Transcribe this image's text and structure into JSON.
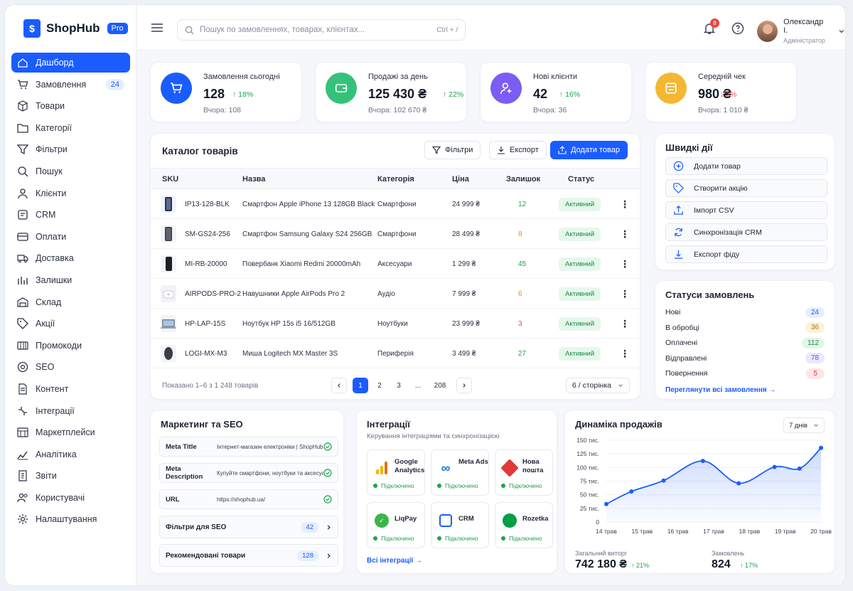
{
  "app": {
    "name": "ShopHub",
    "badge": "Pro"
  },
  "sidebar": {
    "items": [
      {
        "label": "Дашборд",
        "icon": "home-icon",
        "active": true
      },
      {
        "label": "Замовлення",
        "icon": "cart-icon",
        "badge": "24"
      },
      {
        "label": "Товари",
        "icon": "box-icon"
      },
      {
        "label": "Категорії",
        "icon": "folder-icon"
      },
      {
        "label": "Фільтри",
        "icon": "filter-icon"
      },
      {
        "label": "Пошук",
        "icon": "search-icon"
      },
      {
        "label": "Клієнти",
        "icon": "user-icon"
      },
      {
        "label": "CRM",
        "icon": "crm-icon"
      },
      {
        "label": "Оплати",
        "icon": "card-icon"
      },
      {
        "label": "Доставка",
        "icon": "truck-icon"
      },
      {
        "label": "Залишки",
        "icon": "stock-icon"
      },
      {
        "label": "Склад",
        "icon": "warehouse-icon"
      },
      {
        "label": "Акції",
        "icon": "tag-icon"
      },
      {
        "label": "Промокоди",
        "icon": "promo-icon"
      },
      {
        "label": "SEO",
        "icon": "seo-icon"
      },
      {
        "label": "Контент",
        "icon": "content-icon"
      },
      {
        "label": "Інтеграції",
        "icon": "integration-icon"
      },
      {
        "label": "Маркетплейси",
        "icon": "market-icon"
      },
      {
        "label": "Аналітика",
        "icon": "analytics-icon"
      },
      {
        "label": "Звіти",
        "icon": "report-icon"
      },
      {
        "label": "Користувачі",
        "icon": "users-icon"
      },
      {
        "label": "Налаштування",
        "icon": "gear-icon"
      }
    ]
  },
  "topbar": {
    "search_placeholder": "Пошук по замовленнях, товарах, клієнтах...",
    "shortcut": "Ctrl + /",
    "notifications": "8",
    "user_name": "Олександр І.",
    "user_role": "Адміністратор"
  },
  "kpis": [
    {
      "title": "Замовлення сьогодні",
      "value": "128",
      "delta": "↑ 18%",
      "trend": "up",
      "sub": "Вчора: 108",
      "color": "#1a5cff"
    },
    {
      "title": "Продажі за день",
      "value": "125 430 ₴",
      "delta": "↑ 22%",
      "trend": "up",
      "sub": "Вчора: 102 670 ₴",
      "color": "#34c27a"
    },
    {
      "title": "Нові клієнти",
      "value": "42",
      "delta": "↑ 16%",
      "trend": "up",
      "sub": "Вчора: 36",
      "color": "#7b5cf5"
    },
    {
      "title": "Середній чек",
      "value": "980 ₴",
      "delta": "↓ 3%",
      "trend": "down",
      "sub": "Вчора: 1 010 ₴",
      "color": "#f5b731"
    }
  ],
  "catalog": {
    "title": "Каталог товарів",
    "filters": "Фільтри",
    "export": "Експорт",
    "add": "Додати товар",
    "columns": [
      "SKU",
      "Назва",
      "Категорія",
      "Ціна",
      "Залишок",
      "Статус"
    ],
    "rows": [
      {
        "sku": "IP13-128-BLK",
        "name": "Смартфон Apple iPhone 13 128GB Black",
        "cat": "Смартфони",
        "price": "24 999 ₴",
        "stock": "12",
        "stock_color": "#1aa34a",
        "status": "Активний"
      },
      {
        "sku": "SM-GS24-256",
        "name": "Смартфон Samsung Galaxy S24 256GB",
        "cat": "Смартфони",
        "price": "28 499 ₴",
        "stock": "8",
        "stock_color": "#f08c00",
        "status": "Активний"
      },
      {
        "sku": "MI-RB-20000",
        "name": "Повербанк Xiaomi Redmi 20000mAh",
        "cat": "Аксесуари",
        "price": "1 299 ₴",
        "stock": "45",
        "stock_color": "#1aa34a",
        "status": "Активний"
      },
      {
        "sku": "AIRPODS-PRO-2",
        "name": "Навушники Apple AirPods Pro 2",
        "cat": "Аудіо",
        "price": "7 999 ₴",
        "stock": "6",
        "stock_color": "#f08c00",
        "status": "Активний"
      },
      {
        "sku": "HP-LAP-15S",
        "name": "Ноутбук HP 15s i5 16/512GB",
        "cat": "Ноутбуки",
        "price": "23 999 ₴",
        "stock": "3",
        "stock_color": "#ef4444",
        "status": "Активний"
      },
      {
        "sku": "LOGI-MX-M3",
        "name": "Миша Logitech MX Master 3S",
        "cat": "Периферія",
        "price": "3 499 ₴",
        "stock": "27",
        "stock_color": "#1aa34a",
        "status": "Активний"
      }
    ],
    "pagination_info": "Показано 1–6 з 1 248 товарів",
    "pages": [
      "1",
      "2",
      "3",
      "...",
      "208"
    ],
    "per_page": "6 / сторінка"
  },
  "quick_actions": {
    "title": "Швидкі дії",
    "items": [
      {
        "label": "Додати товар",
        "icon": "plus-circle-icon"
      },
      {
        "label": "Створити акцію",
        "icon": "tag-icon"
      },
      {
        "label": "Імпорт CSV",
        "icon": "upload-icon"
      },
      {
        "label": "Синхронізація CRM",
        "icon": "sync-icon"
      },
      {
        "label": "Експорт фіду",
        "icon": "download-icon"
      }
    ]
  },
  "order_status": {
    "title": "Статуси замовлень",
    "items": [
      {
        "label": "Нові",
        "count": "24",
        "bg": "#e6eefe",
        "fg": "#1a5cff"
      },
      {
        "label": "В обробці",
        "count": "36",
        "bg": "#fdf1d9",
        "fg": "#b57900"
      },
      {
        "label": "Оплачені",
        "count": "112",
        "bg": "#e3f6e9",
        "fg": "#1a8a3e"
      },
      {
        "label": "Відправлені",
        "count": "78",
        "bg": "#ece7fd",
        "fg": "#6a4fe0"
      },
      {
        "label": "Повернення",
        "count": "5",
        "bg": "#fde6e6",
        "fg": "#e03b3b"
      }
    ],
    "link": "Переглянути всі замовлення →"
  },
  "marketing": {
    "title": "Маркетинг та SEO",
    "fields": [
      {
        "key": "Meta Title",
        "value": "Інтернет-магазин електроніки | ShopHub"
      },
      {
        "key": "Meta Description",
        "value": "Купуйте смартфони, ноутбуки та аксесуари..."
      },
      {
        "key": "URL",
        "value": "https://shophub.ua/"
      }
    ],
    "links": [
      {
        "label": "Фільтри для SEO",
        "count": "42"
      },
      {
        "label": "Рекомендовані товари",
        "count": "128"
      }
    ]
  },
  "integrations": {
    "title": "Інтеграції",
    "subtitle": "Керування інтеграціями та синхронізацією",
    "status": "Підключено",
    "tiles": [
      {
        "name": "Google Analytics",
        "icon": "google-analytics-icon"
      },
      {
        "name": "Meta Ads",
        "icon": "meta-icon"
      },
      {
        "name": "Нова пошта",
        "icon": "nova-poshta-icon"
      },
      {
        "name": "LiqPay",
        "icon": "liqpay-icon"
      },
      {
        "name": "CRM",
        "icon": "crm-icon"
      },
      {
        "name": "Rozetka",
        "icon": "rozetka-icon"
      }
    ],
    "link": "Всі інтеграції →"
  },
  "sales": {
    "title": "Динаміка продажів",
    "period": "7 днів",
    "total_label": "Загальний виторг",
    "total_value": "742 180 ₴",
    "total_delta": "↑ 21%",
    "orders_label": "Замовлень",
    "orders_value": "824",
    "orders_delta": "↑ 17%"
  },
  "chart_data": {
    "type": "area",
    "title": "Динаміка продажів",
    "x": [
      "14 трав",
      "15 трав",
      "16 трав",
      "17 трав",
      "18 трав",
      "19 трав",
      "20 трав"
    ],
    "yticks": [
      "0",
      "25 тис.",
      "50 тис.",
      "75 тис.",
      "100 тис.",
      "125 тис.",
      "150 тис."
    ],
    "ylim": [
      0,
      150000
    ],
    "series": [
      {
        "values": [
          33000,
          56000,
          76000,
          112000,
          71000,
          99000,
          136000
        ]
      }
    ],
    "markers": [
      {
        "x": 0,
        "y": 33000
      },
      {
        "x": 0.7,
        "y": 56000
      },
      {
        "x": 1.6,
        "y": 76000
      },
      {
        "x": 2.7,
        "y": 112000
      },
      {
        "x": 3.7,
        "y": 71000
      },
      {
        "x": 4.7,
        "y": 101000
      },
      {
        "x": 5.4,
        "y": 98000
      },
      {
        "x": 6,
        "y": 136000
      }
    ],
    "grid": true,
    "color": "#1a5cff"
  }
}
